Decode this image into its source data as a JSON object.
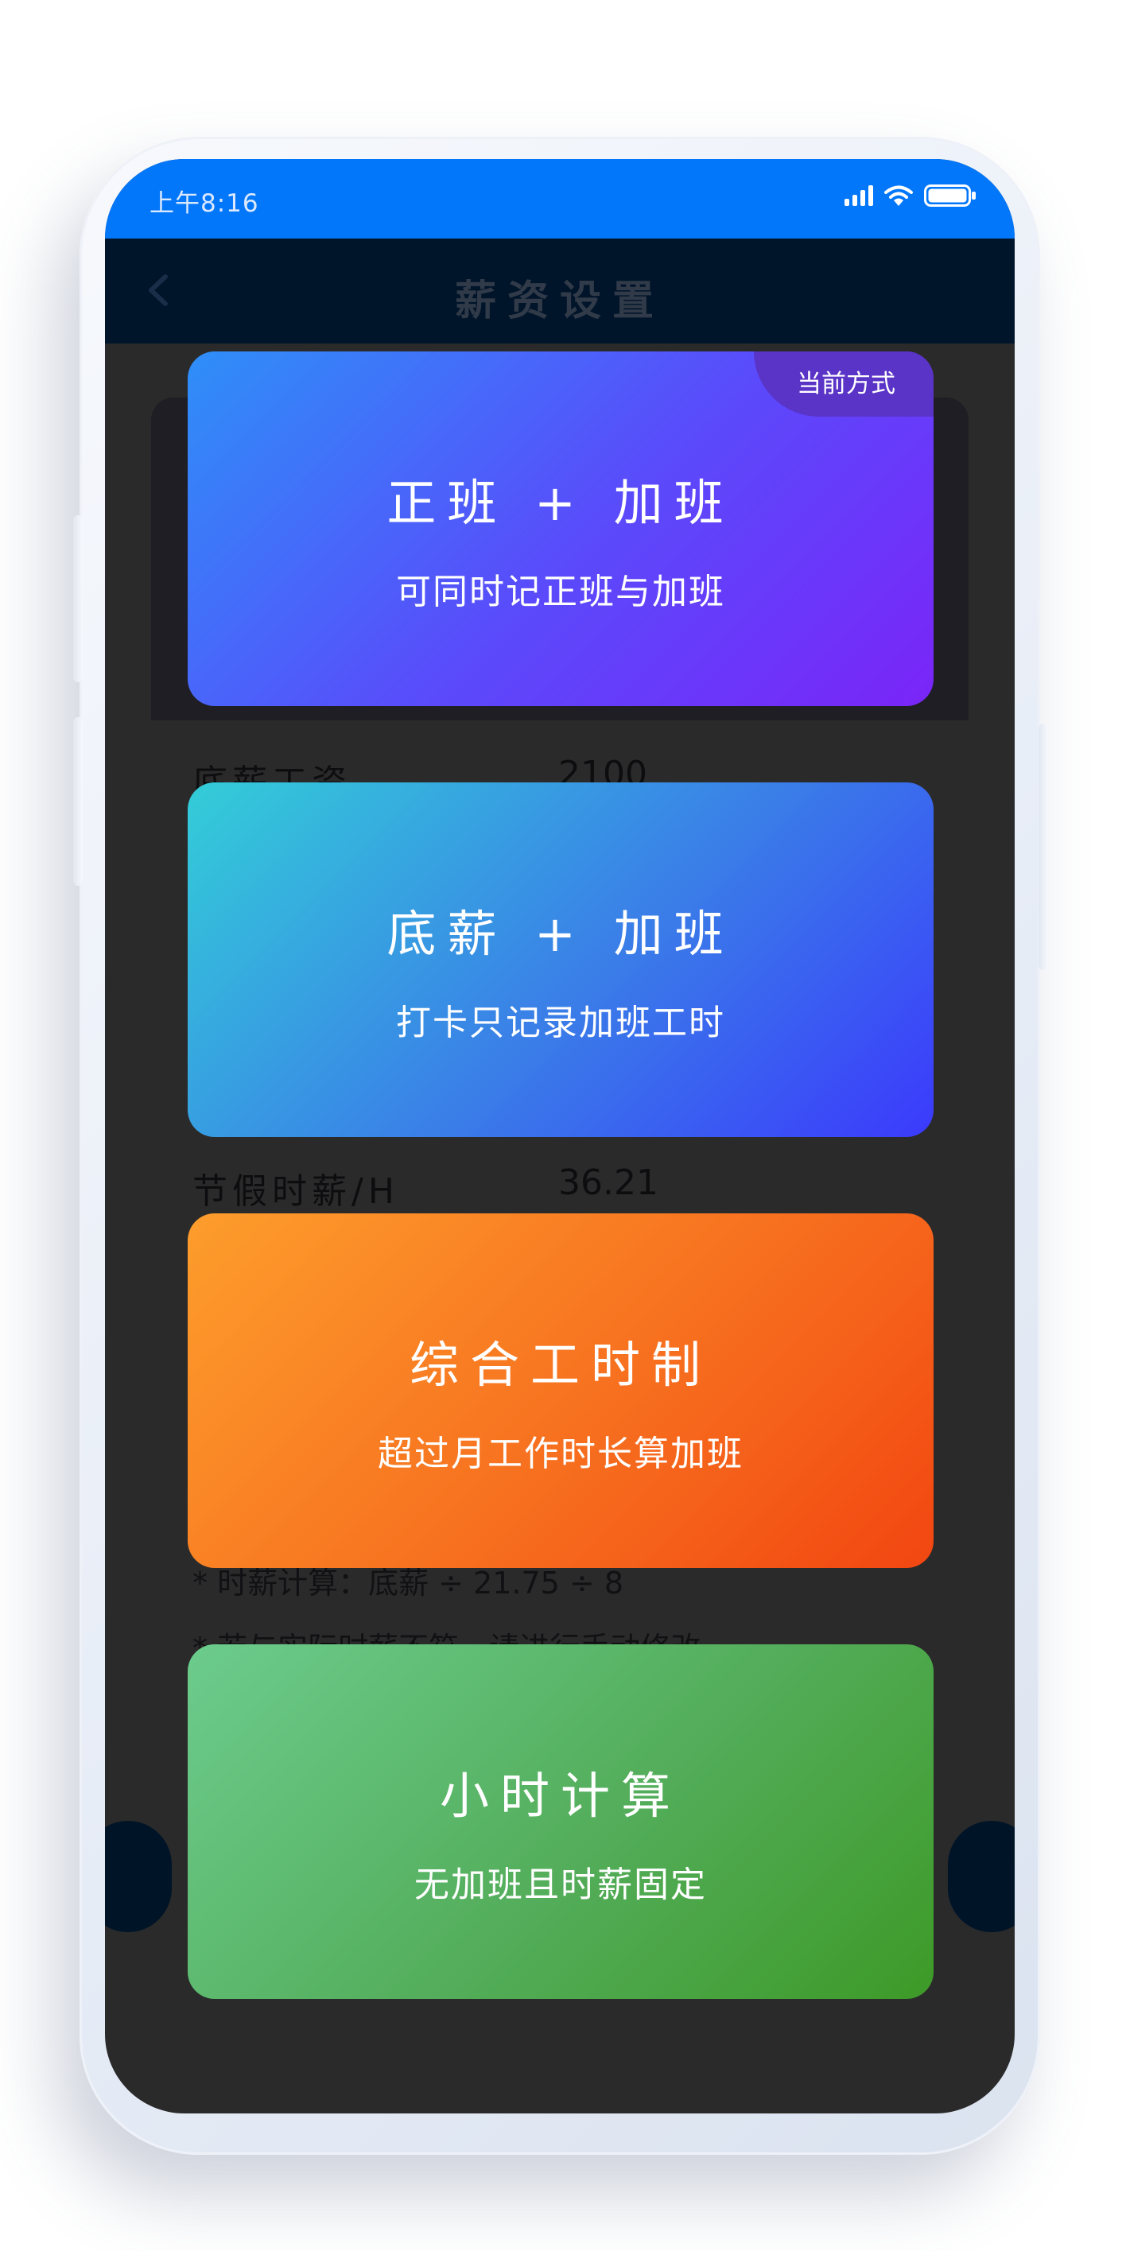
{
  "status_bar": {
    "time": "上午8:16",
    "icons": [
      "signal-icon",
      "wifi-icon",
      "battery-icon"
    ]
  },
  "nav": {
    "title": "薪资设置",
    "back_icon": "chevron-left-icon"
  },
  "background_page": {
    "rows": [
      {
        "label": "底薪工资",
        "value": "2100"
      },
      {
        "label": "节假时薪/H",
        "value": "36.21"
      }
    ],
    "notes": [
      "* 时薪计算：底薪 ÷ 21.75 ÷ 8",
      "* 若与实际时薪不符，请进行手动修改"
    ]
  },
  "modes": [
    {
      "title": "正班 + 加班",
      "subtitle": "可同时记正班与加班",
      "badge": "当前方式"
    },
    {
      "title": "底薪 + 加班",
      "subtitle": "打卡只记录加班工时"
    },
    {
      "title": "综合工时制",
      "subtitle": "超过月工作时长算加班"
    },
    {
      "title": "小时计算",
      "subtitle": "无加班且时薪固定"
    }
  ],
  "colors": {
    "status_bar": "#0277fa",
    "nav_bar": "#00142a",
    "overlay": "#2a2a2a",
    "mode_1": [
      "#2e8ff8",
      "#7a25f8"
    ],
    "mode_2": [
      "#33cdd8",
      "#3b3afc"
    ],
    "mode_3": [
      "#fd9d2c",
      "#f24611"
    ],
    "mode_4": [
      "#6ccc8d",
      "#3d9a27"
    ]
  }
}
